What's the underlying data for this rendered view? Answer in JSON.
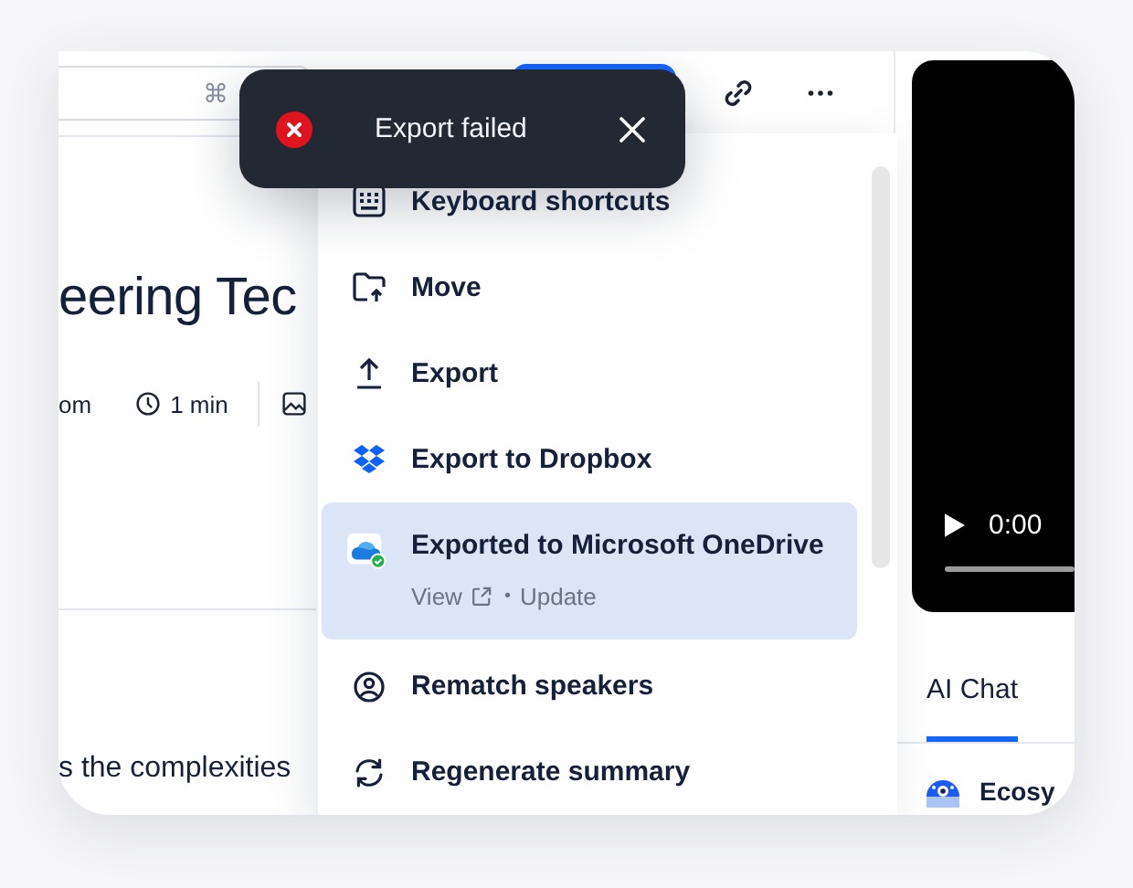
{
  "search": {
    "shortcut": "⌘"
  },
  "toast": {
    "kind": "error",
    "message": "Export failed"
  },
  "document": {
    "title": "eering Tec",
    "meta": [
      {
        "kind": "text",
        "text": "om"
      },
      {
        "kind": "duration",
        "text": "1 min"
      },
      {
        "kind": "images"
      }
    ],
    "body": "s the complexities"
  },
  "menu": {
    "items": [
      {
        "kind": "keyboard",
        "label": "Keyboard shortcuts",
        "selected": false
      },
      {
        "kind": "move",
        "label": "Move",
        "selected": false
      },
      {
        "kind": "export",
        "label": "Export",
        "selected": false
      },
      {
        "kind": "dropbox",
        "label": "Export to Dropbox",
        "selected": false
      },
      {
        "kind": "onedrive",
        "label": "Exported to Microsoft OneDrive",
        "selected": true,
        "links": [
          "View",
          "Update"
        ],
        "separator": "•"
      },
      {
        "kind": "speakers",
        "label": "Rematch speakers",
        "selected": false
      },
      {
        "kind": "regenerate",
        "label": "Regenerate summary",
        "selected": false
      }
    ]
  },
  "player": {
    "time": "0:00"
  },
  "side_tabs": [
    {
      "label": "AI Chat",
      "selected": true
    }
  ],
  "chat_items": [
    {
      "title": "Ecosy"
    }
  ]
}
